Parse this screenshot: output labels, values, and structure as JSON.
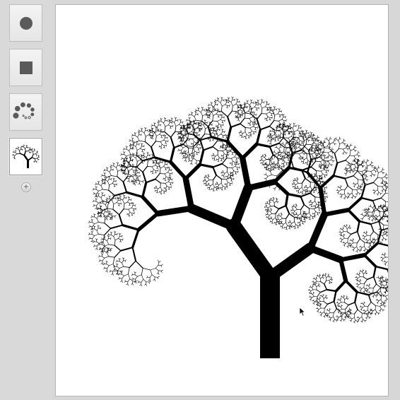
{
  "sidebar": {
    "thumbnails": [
      {
        "icon": "circle-icon"
      },
      {
        "icon": "square-icon"
      },
      {
        "icon": "spiral-icon"
      },
      {
        "icon": "fractal-tree-icon",
        "selected": true
      }
    ],
    "add_button": {
      "label": "+",
      "icon": "plus-icon"
    }
  },
  "canvas": {
    "drawing": "pythagoras-tree-fractal",
    "colors": {
      "fill": "#000000",
      "background": "#ffffff"
    }
  }
}
